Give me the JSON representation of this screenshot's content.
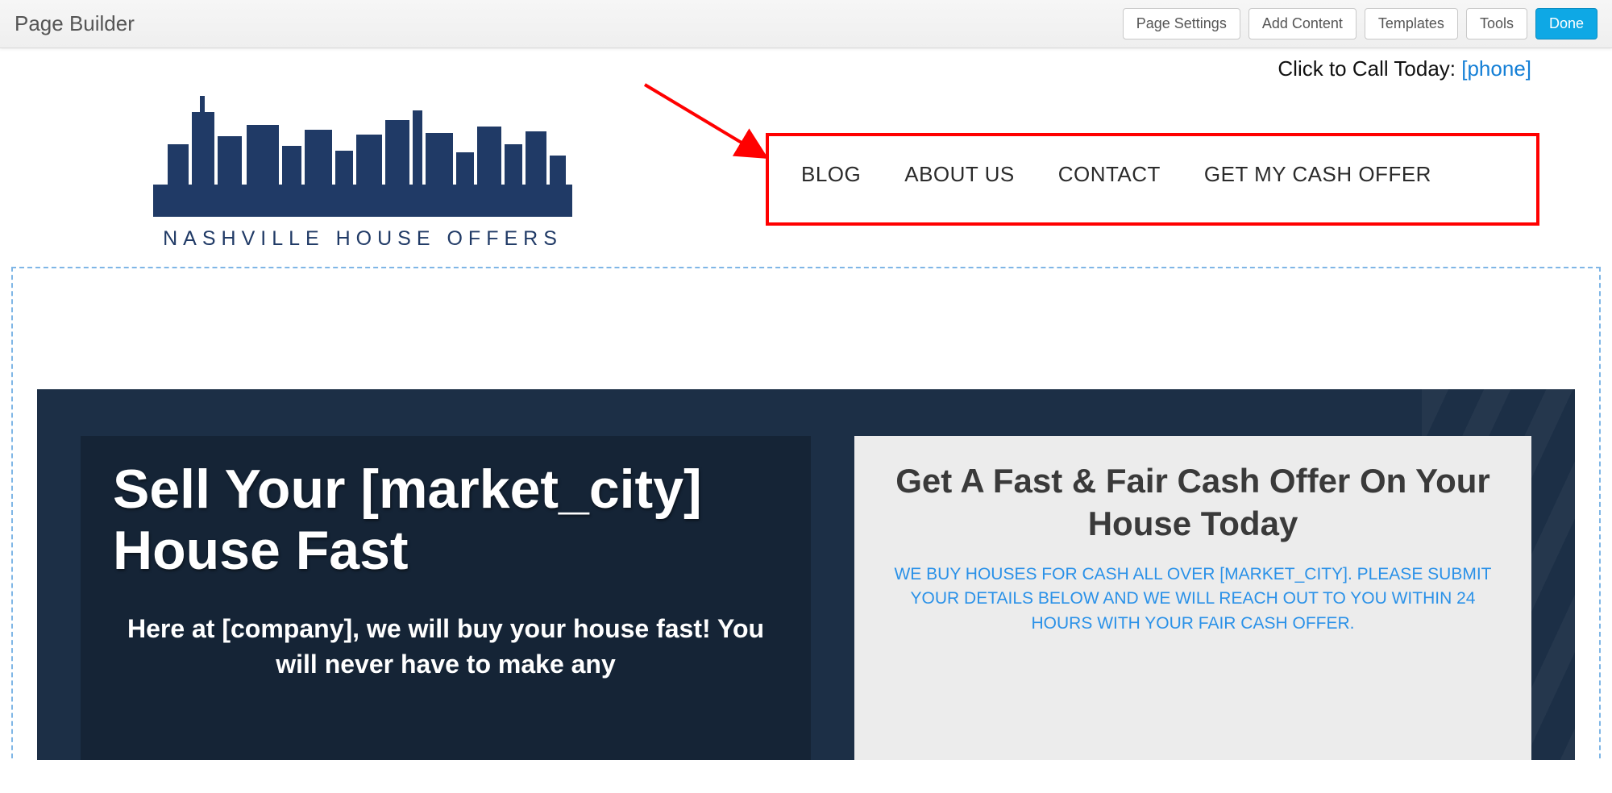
{
  "toolbar": {
    "title": "Page Builder",
    "buttons": {
      "page_settings": "Page Settings",
      "add_content": "Add Content",
      "templates": "Templates",
      "tools": "Tools",
      "done": "Done"
    }
  },
  "click_to_call": {
    "label": "Click to Call Today: ",
    "phone": "[phone]"
  },
  "logo": {
    "caption": "NASHVILLE HOUSE OFFERS"
  },
  "nav": {
    "items": [
      "BLOG",
      "ABOUT US",
      "CONTACT",
      "GET MY CASH OFFER"
    ]
  },
  "hero": {
    "headline": "Sell Your [market_city] House Fast",
    "sub": "Here at [company], we will buy your house fast! You will never have to make any"
  },
  "offer": {
    "heading": "Get A Fast & Fair Cash Offer On Your House Today",
    "sub": "WE BUY HOUSES FOR CASH ALL OVER [MARKET_CITY]. PLEASE SUBMIT YOUR DETAILS BELOW AND WE WILL REACH OUT TO YOU WITHIN 24 HOURS WITH YOUR FAIR CASH OFFER."
  }
}
